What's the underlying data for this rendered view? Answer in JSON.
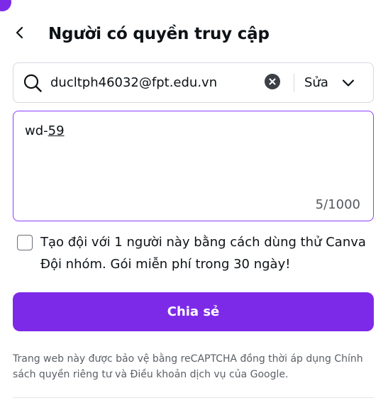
{
  "header": {
    "title": "Người có quyền truy cập"
  },
  "search": {
    "value": "ducltph46032@fpt.edu.vn",
    "role_label": "Sửa"
  },
  "message": {
    "text_prefix": "wd-",
    "text_suffix": "59",
    "char_count": "5/1000"
  },
  "trial": {
    "label": "Tạo đội với 1 người này bằng cách dùng thử Canva Đội nhóm. Gói miễn phí trong 30 ngày!",
    "checked": false
  },
  "share_button": {
    "label": "Chia sẻ"
  },
  "footer": {
    "note": "Trang web này được bảo vệ bằng reCAPTCHA đồng thời áp dụng Chính sách quyền riêng tư và Điều khoản dịch vụ của Google."
  },
  "colors": {
    "accent": "#7d2ae8",
    "focus_border": "#8b3dff",
    "text": "#0d1216"
  },
  "icons": [
    "chevron-left-icon",
    "search-icon",
    "clear-icon",
    "chevron-down-icon"
  ]
}
